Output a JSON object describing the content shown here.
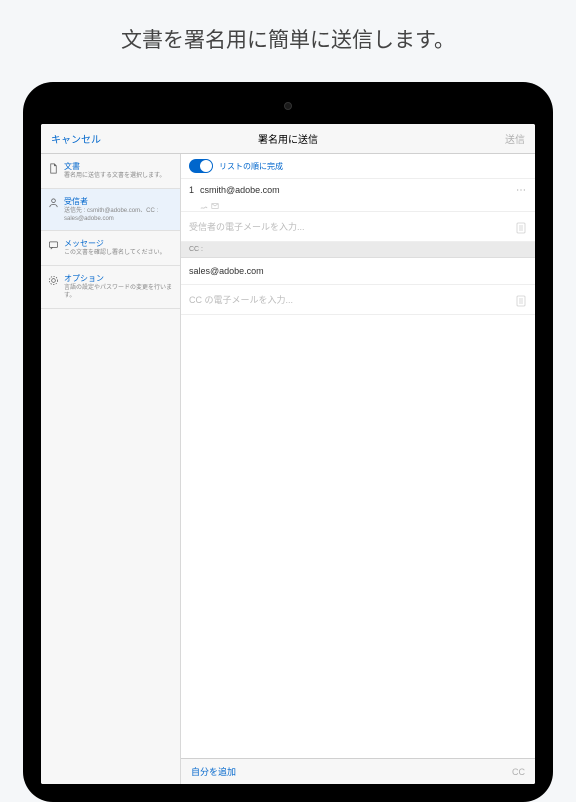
{
  "page": {
    "title": "文書を署名用に簡単に送信します。"
  },
  "nav": {
    "cancel": "キャンセル",
    "title": "署名用に送信",
    "send": "送信"
  },
  "sidebar": {
    "items": [
      {
        "label": "文書",
        "desc": "署名用に送信する文書を選択します。"
      },
      {
        "label": "受信者",
        "desc": "送信先 : csmith@adobe.com、CC : sales@adobe.com"
      },
      {
        "label": "メッセージ",
        "desc": "この文書を確認し署名してください。"
      },
      {
        "label": "オプション",
        "desc": "言語の設定やパスワードの変更を行います。"
      }
    ]
  },
  "main": {
    "toggle_label": "リストの順に完成",
    "recipients": [
      {
        "num": "1",
        "email": "csmith@adobe.com"
      }
    ],
    "recipient_input_placeholder": "受信者の電子メールを入力...",
    "cc_header": "CC :",
    "cc_entries": [
      "sales@adobe.com"
    ],
    "cc_input_placeholder": "CC の電子メールを入力..."
  },
  "bottom": {
    "add_self": "自分を追加",
    "cc": "CC"
  }
}
